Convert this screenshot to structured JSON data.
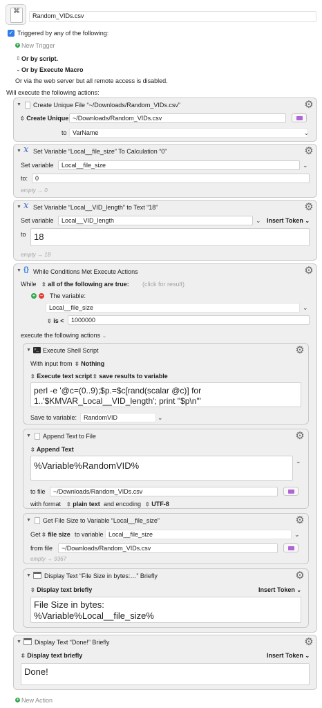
{
  "macro": {
    "name": "Random_VIDs.csv",
    "triggered_label": "Triggered by any of the following:",
    "new_trigger": "New Trigger",
    "or_script": "Or by script.",
    "or_execute_macro": "Or by Execute Macro",
    "web_server_note": "Or via the web server but all remote access is disabled.",
    "will_execute": "Will execute the following actions:",
    "new_action": "New Action"
  },
  "actions": {
    "a1": {
      "title": "Create Unique File “~/Downloads/Random_VIDs.csv”",
      "mode": "Create Unique",
      "path": "~/Downloads/Random_VIDs.csv",
      "to_label": "to",
      "var": "VarName"
    },
    "a2": {
      "title": "Set Variable “Local__file_size” To Calculation “0”",
      "set_label": "Set variable",
      "var": "Local__file_size",
      "to_label": "to:",
      "value": "0",
      "result_empty": "empty",
      "result_value": "0"
    },
    "a3": {
      "title": "Set Variable “Local__VID_length” to Text “18”",
      "set_label": "Set variable",
      "var": "Local__VID_length",
      "insert_token": "Insert Token",
      "to_label": "to",
      "value": "18",
      "result_empty": "empty",
      "result_value": "18"
    },
    "a4": {
      "title": "While Conditions Met Execute Actions",
      "while_label": "While",
      "condition_mode": "all of the following are true:",
      "click_result": "(click for result)",
      "the_variable": "The variable:",
      "var": "Local__file_size",
      "operator": "is <",
      "compare_value": "1000000",
      "execute_label": "execute the following actions"
    },
    "shell": {
      "title": "Execute Shell Script",
      "input_label": "With input from",
      "input_value": "Nothing",
      "exec_mode": "Execute text script",
      "save_mode": "save results to variable",
      "script_line1": "perl -e '@c=(0..9);$p.=$c[rand(scalar @c)] for",
      "script_line2": "1..'$KMVAR_Local__VID_length'; print \"$p\\n\"'",
      "save_label": "Save to variable:",
      "save_var": "RandomVID"
    },
    "append": {
      "title": "Append Text to File",
      "mode": "Append Text",
      "text": "%Variable%RandomVID%",
      "to_file_label": "to file",
      "path": "~/Downloads/Random_VIDs.csv",
      "with_format_label": "with format",
      "format": "plain text",
      "encoding_label": "and encoding",
      "encoding": "UTF-8"
    },
    "filesize": {
      "title": "Get File Size to Variable “Local__file_size”",
      "get_label": "Get",
      "attr": "file size",
      "to_variable_label": "to variable",
      "var": "Local__file_size",
      "from_label": "from file",
      "path": "~/Downloads/Random_VIDs.csv",
      "result_empty": "empty",
      "result_value": "9367"
    },
    "display1": {
      "title": "Display Text “File Size in bytes:…” Briefly",
      "mode": "Display text briefly",
      "insert_token": "Insert Token",
      "text_line1": "File Size in bytes:",
      "text_line2": "%Variable%Local__file_size%"
    },
    "display2": {
      "title": "Display Text “Done!” Briefly",
      "mode": "Display text briefly",
      "insert_token": "Insert Token",
      "text": "Done!"
    }
  },
  "colors": {
    "accent": "#2f7ce8",
    "add_green": "#34a853",
    "remove_red": "#e0433a",
    "folder_purple": "#b064d6",
    "variable_icon": "#3a5fc8"
  }
}
